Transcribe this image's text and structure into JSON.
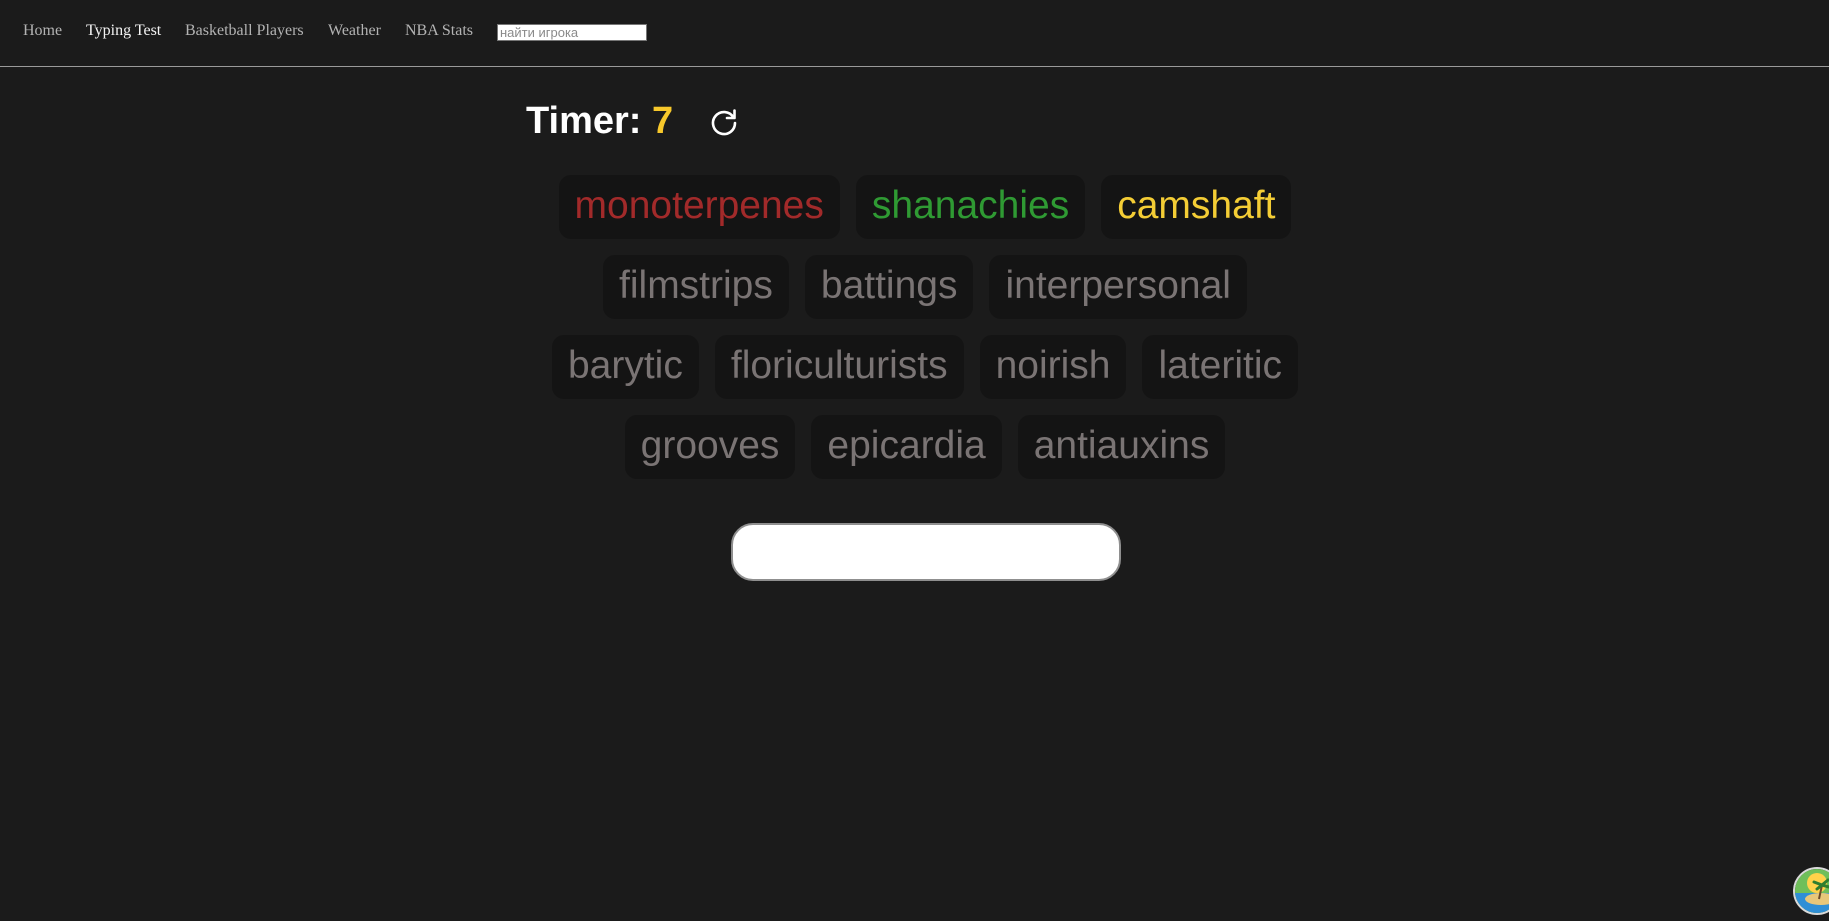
{
  "nav": {
    "items": [
      {
        "label": "Home",
        "active": false
      },
      {
        "label": "Typing Test",
        "active": true
      },
      {
        "label": "Basketball Players",
        "active": false
      },
      {
        "label": "Weather",
        "active": false
      },
      {
        "label": "NBA Stats",
        "active": false
      }
    ],
    "search_placeholder": "найти игрока"
  },
  "timer": {
    "label": "Timer:",
    "value": "7",
    "value_color": "#f7c82b",
    "reset_icon": "refresh-icon"
  },
  "words": {
    "colors": {
      "wrong": "#a22a2a",
      "right": "#2f9a33",
      "current": "#f4cd35",
      "pending": "#7a7474"
    },
    "rows": [
      [
        {
          "text": "monoterpenes",
          "state": "wrong"
        },
        {
          "text": "shanachies",
          "state": "right"
        },
        {
          "text": "camshaft",
          "state": "current"
        }
      ],
      [
        {
          "text": "filmstrips",
          "state": "pending"
        },
        {
          "text": "battings",
          "state": "pending"
        },
        {
          "text": "interpersonal",
          "state": "pending"
        }
      ],
      [
        {
          "text": "barytic",
          "state": "pending"
        },
        {
          "text": "floriculturists",
          "state": "pending"
        },
        {
          "text": "noirish",
          "state": "pending"
        },
        {
          "text": "lateritic",
          "state": "pending"
        }
      ],
      [
        {
          "text": "grooves",
          "state": "pending"
        },
        {
          "text": "epicardia",
          "state": "pending"
        },
        {
          "text": "antiauxins",
          "state": "pending"
        }
      ]
    ]
  },
  "typing_input": {
    "value": ""
  },
  "corner_badge": {
    "icon": "island-avatar-icon"
  }
}
